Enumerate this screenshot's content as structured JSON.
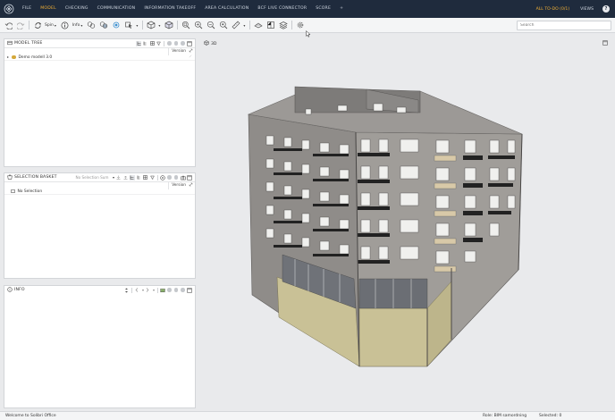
{
  "menu": {
    "items": [
      "FILE",
      "MODEL",
      "CHECKING",
      "COMMUNICATION",
      "INFORMATION TAKEOFF",
      "AREA CALCULATION",
      "BCF LIVE CONNECTOR",
      "SCORE",
      "+"
    ],
    "active_index": 1,
    "todo_label": "ALL TO-DO (0/1)",
    "views_label": "VIEWS",
    "help_label": "?",
    "colors": {
      "bar": "#1f2b3d",
      "active": "#f2b035",
      "text": "#cfd6e0"
    }
  },
  "toolbar": {
    "spin_label": "Spin",
    "info_label": "Info",
    "search_placeholder": "Search"
  },
  "model_tree": {
    "title": "MODEL TREE",
    "version_col": "Version",
    "rows": [
      {
        "label": "Demo modell 3.0"
      }
    ]
  },
  "selection_basket": {
    "title": "SELECTION BASKET",
    "info": "No Selection Sum",
    "version_col": "Version",
    "rows": [
      {
        "label": "No Selection"
      }
    ]
  },
  "info_panel": {
    "title": "INFO"
  },
  "view": {
    "title": "3D"
  },
  "status": {
    "message": "Welcome to Solibri Office",
    "role": "Role: BIM samordning",
    "selected": "Selected: 0"
  },
  "icons": [
    "solibri-logo-icon",
    "undo-icon",
    "redo-icon",
    "spin-icon",
    "info-icon",
    "hide-icon",
    "isolate-icon",
    "transparency-icon",
    "select-icon",
    "view-cube-icon",
    "box-icon",
    "fit-icon",
    "zoom-in-icon",
    "zoom-out-icon",
    "zoom-window-icon",
    "measure-icon",
    "section-icon",
    "floor-plan-icon",
    "layers-icon",
    "settings-icon",
    "panel-maximize-icon",
    "cube-3d-icon"
  ]
}
